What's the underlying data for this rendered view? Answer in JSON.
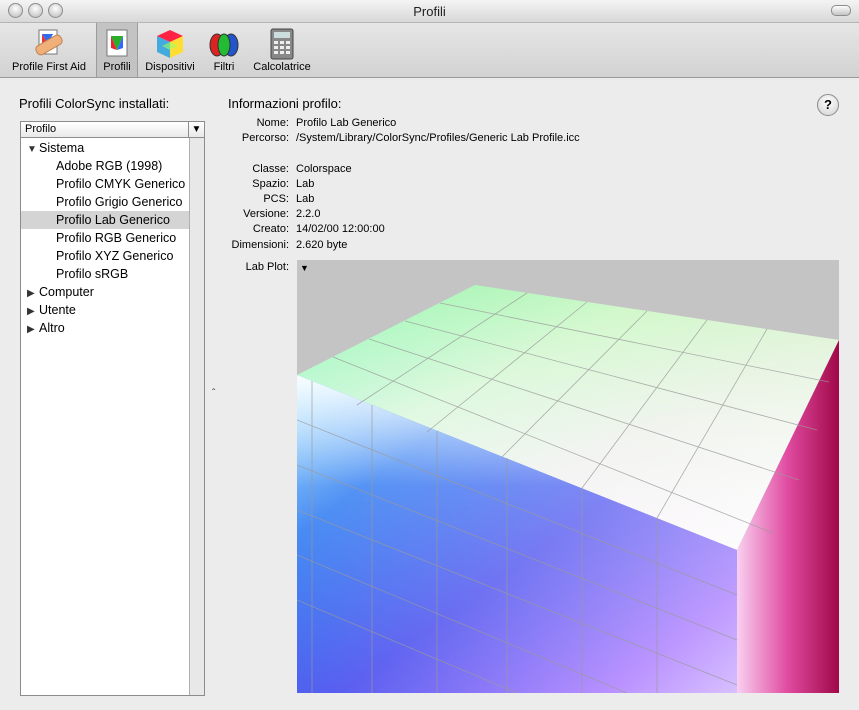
{
  "window": {
    "title": "Profili"
  },
  "toolbar": {
    "items": [
      {
        "label": "Profile First Aid",
        "icon": "first-aid-icon"
      },
      {
        "label": "Profili",
        "icon": "profile-document-icon",
        "selected": true
      },
      {
        "label": "Dispositivi",
        "icon": "device-cube-icon"
      },
      {
        "label": "Filtri",
        "icon": "filter-icon"
      },
      {
        "label": "Calcolatrice",
        "icon": "calculator-icon"
      }
    ]
  },
  "left": {
    "title": "Profili ColorSync installati:",
    "column_header": "Profilo",
    "tree": [
      {
        "label": "Sistema",
        "expanded": true,
        "level": 0
      },
      {
        "label": "Adobe RGB (1998)",
        "level": 1
      },
      {
        "label": "Profilo CMYK Generico",
        "level": 1
      },
      {
        "label": "Profilo Grigio Generico",
        "level": 1
      },
      {
        "label": "Profilo Lab Generico",
        "level": 1,
        "selected": true
      },
      {
        "label": "Profilo RGB Generico",
        "level": 1
      },
      {
        "label": "Profilo XYZ Generico",
        "level": 1
      },
      {
        "label": "Profilo sRGB",
        "level": 1
      },
      {
        "label": "Computer",
        "expanded": false,
        "level": 0
      },
      {
        "label": "Utente",
        "expanded": false,
        "level": 0
      },
      {
        "label": "Altro",
        "expanded": false,
        "level": 0
      }
    ]
  },
  "info": {
    "title": "Informazioni profilo:",
    "help_label": "?",
    "fields": {
      "nome_label": "Nome:",
      "nome": "Profilo Lab Generico",
      "percorso_label": "Percorso:",
      "percorso": "/System/Library/ColorSync/Profiles/Generic Lab Profile.icc",
      "classe_label": "Classe:",
      "classe": "Colorspace",
      "spazio_label": "Spazio:",
      "spazio": "Lab",
      "pcs_label": "PCS:",
      "pcs": "Lab",
      "versione_label": "Versione:",
      "versione": "2.2.0",
      "creato_label": "Creato:",
      "creato": "14/02/00 12:00:00",
      "dimensioni_label": "Dimensioni:",
      "dimensioni": "2.620 byte"
    },
    "plot_label": "Lab Plot:"
  },
  "colors": {
    "selected_row": "#d4d4d4",
    "plot_background": "#c4c4c4",
    "window": "#ececec"
  }
}
